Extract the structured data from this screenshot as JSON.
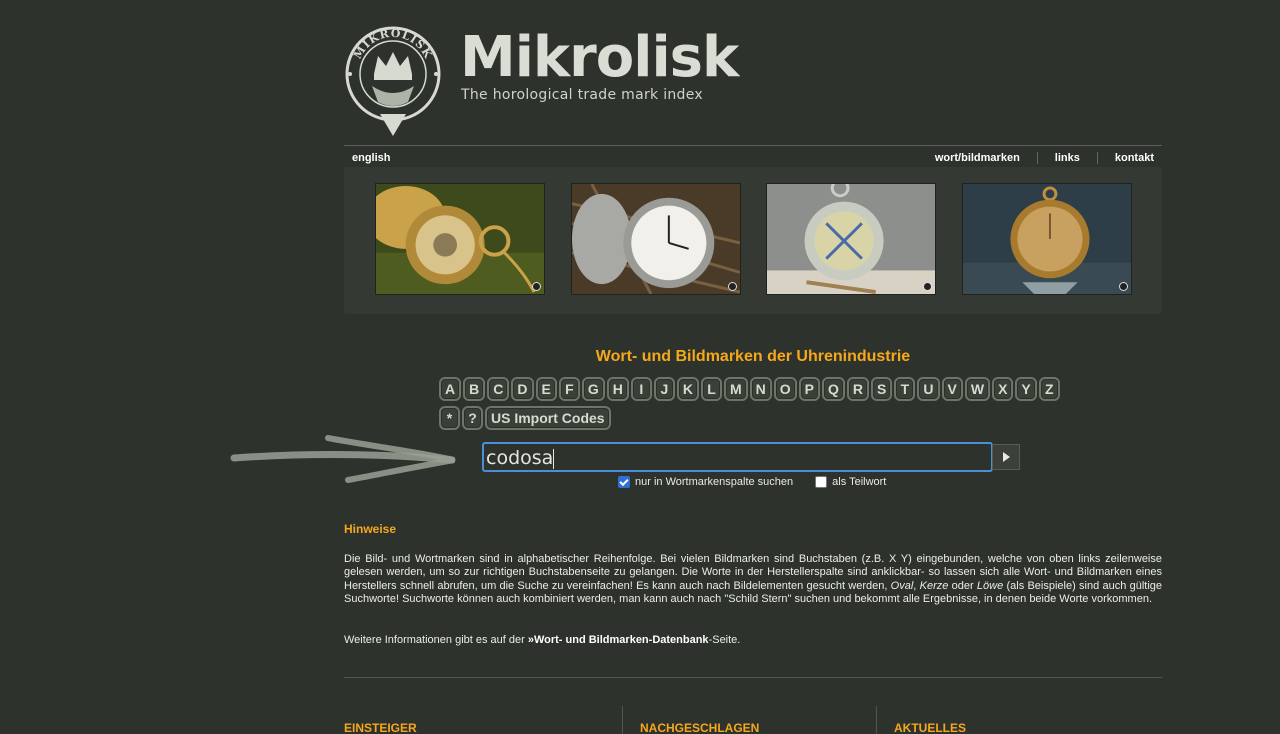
{
  "brand": {
    "name": "Mikrolisk",
    "tagline": "The horological trade mark index",
    "seal_text": "MIKROLISK"
  },
  "nav": {
    "language": "english",
    "items": [
      "wort/bildmarken",
      "links",
      "kontakt"
    ]
  },
  "heading": "Wort- und Bildmarken der Uhrenindustrie",
  "letters": [
    "A",
    "B",
    "C",
    "D",
    "E",
    "F",
    "G",
    "H",
    "I",
    "J",
    "K",
    "L",
    "M",
    "N",
    "O",
    "P",
    "Q",
    "R",
    "S",
    "T",
    "U",
    "V",
    "W",
    "X",
    "Y",
    "Z"
  ],
  "extra_keys": [
    "*",
    "?",
    "US Import Codes"
  ],
  "search": {
    "value": "codosa"
  },
  "options": {
    "word_column_label": "nur in Wortmarkenspalte suchen",
    "word_column_checked": true,
    "partial_label": "als Teilwort",
    "partial_checked": false
  },
  "hinweise": {
    "title": "Hinweise",
    "p1a": "Die Bild- und Wortmarken sind in alphabetischer Reihenfolge. Bei vielen Bildmarken sind Buchstaben (z.B. X Y) eingebunden, welche von oben links zeilenweise gelesen werden, um so zur richtigen Buchstabenseite zu gelangen. Die Worte in der Herstellerspalte sind anklickbar- so lassen sich alle Wort- und Bildmarken eines Herstellers schnell abrufen, um die Suche zu vereinfachen! Es kann auch nach Bildelementen gesucht werden, ",
    "p1_oval": "Oval",
    "p1_sep1": ", ",
    "p1_kerze": "Kerze",
    "p1_sep2": " oder ",
    "p1_loewe": "Löwe",
    "p1b": " (als Beispiele) sind auch gültige Suchworte! Suchworte können auch kombiniert werden, man kann auch nach \"Schild Stern\" suchen und bekommt alle Ergebnisse, in denen beide Worte vorkommen.",
    "p2a": "Weitere Informationen gibt es auf der ",
    "p2_link": "»Wort- und Bildmarken-Datenbank",
    "p2b": "-Seite."
  },
  "footer": {
    "col1": "EINSTEIGER",
    "col2": "NACHGESCHLAGEN",
    "col3": "AKTUELLES"
  },
  "colors": {
    "background": "#2d322c",
    "accent": "#f5a81c",
    "focus": "#4a8fd8"
  }
}
